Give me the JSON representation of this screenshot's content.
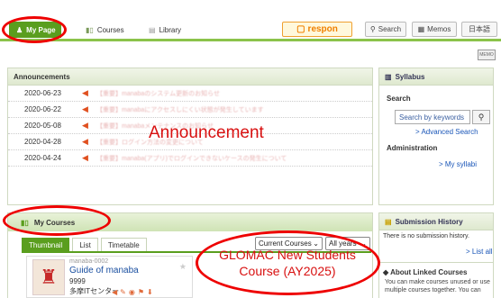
{
  "topnav": {
    "mypage": "My Page",
    "courses": "Courses",
    "library": "Library",
    "brand": "respon",
    "search": "Search",
    "memos": "Memos",
    "lang": "日本語"
  },
  "announcements": {
    "header": "Announcements",
    "overlay_title": "Announcement",
    "rows": [
      {
        "date": "2020-06-23",
        "text": "【重要】manabaのシステム更新のお知らせ"
      },
      {
        "date": "2020-06-22",
        "text": "【重要】manabaにアクセスしにくい状態が発生しています"
      },
      {
        "date": "2020-05-08",
        "text": "【重要】manabaメンテナンスのお知らせ"
      },
      {
        "date": "2020-04-28",
        "text": "【重要】ログイン方法の変更について"
      },
      {
        "date": "2020-04-24",
        "text": "【重要】manaba(アプリ)でログインできないケースの発生について"
      }
    ]
  },
  "mycourses": {
    "header": "My Courses",
    "tabs": [
      "Thumbnail",
      "List",
      "Timetable"
    ],
    "filter_current": "Current Courses",
    "filter_years": "All years",
    "card1": {
      "code": "manaba-0002",
      "title": "Guide of manaba",
      "year": "9999",
      "org": "多摩ITセンター"
    },
    "glomac_line1": "GLOMAC New Students",
    "glomac_line2": "Course (AY2025)"
  },
  "syllabus": {
    "header": "Syllabus",
    "search_label": "Search",
    "search_placeholder": "Search by keywords",
    "advanced": "> Advanced Search",
    "admin_label": "Administration",
    "my_syllabi": "> My syllabi"
  },
  "submission": {
    "header": "Submission History",
    "empty": "There is no submission history.",
    "list_all": "> List all"
  },
  "linked": {
    "header": "About Linked Courses",
    "text": "You can make courses unused or use multiple courses together. You can"
  },
  "colors": {
    "accent_green": "#5a9e1e",
    "highlight_red": "#e00000",
    "brand_orange": "#f08000"
  }
}
